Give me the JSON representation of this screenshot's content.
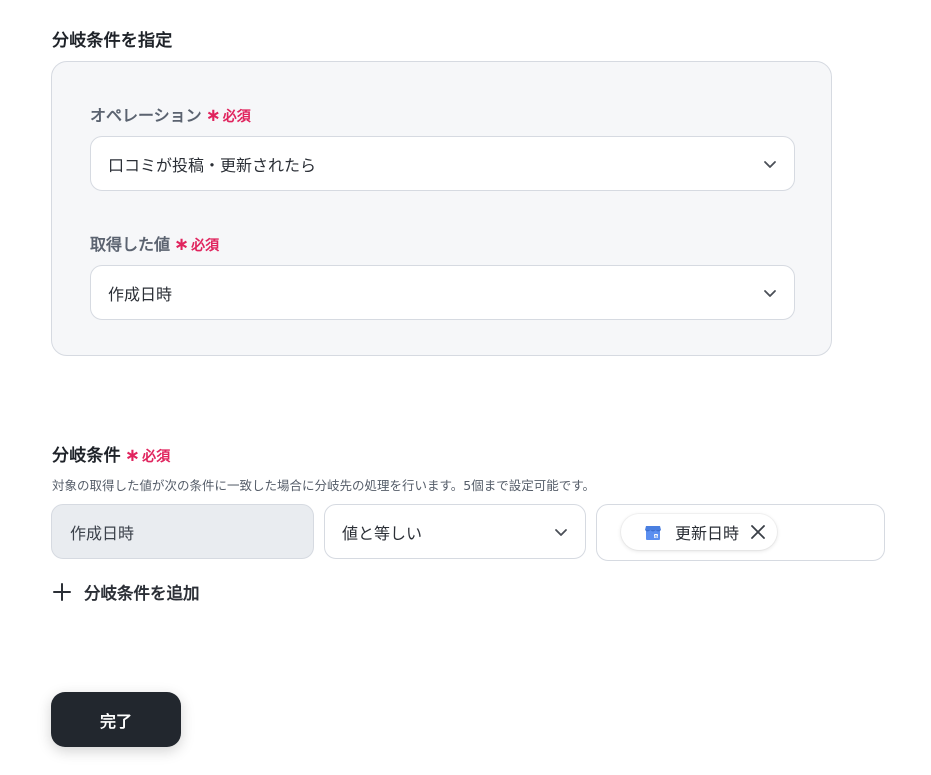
{
  "specify_section": {
    "title": "分岐条件を指定",
    "operation": {
      "label": "オペレーション",
      "required": "必須",
      "value": "口コミが投稿・更新されたら"
    },
    "retrieved_value": {
      "label": "取得した値",
      "required": "必須",
      "value": "作成日時"
    }
  },
  "condition_section": {
    "title": "分岐条件",
    "required": "必須",
    "description": "対象の取得した値が次の条件に一致した場合に分岐先の処理を行います。5個まで設定可能です。",
    "field_value": "作成日時",
    "operator": "値と等しい",
    "value_chip": {
      "label": "更新日時",
      "icon": "google-business-icon"
    },
    "add_label": "分岐条件を追加"
  },
  "footer": {
    "done_label": "完了"
  },
  "colors": {
    "required": "#e0245e",
    "primary_button": "#22272e",
    "panel_bg": "#f6f7f9",
    "icon_blue": "#4a7fe0"
  }
}
